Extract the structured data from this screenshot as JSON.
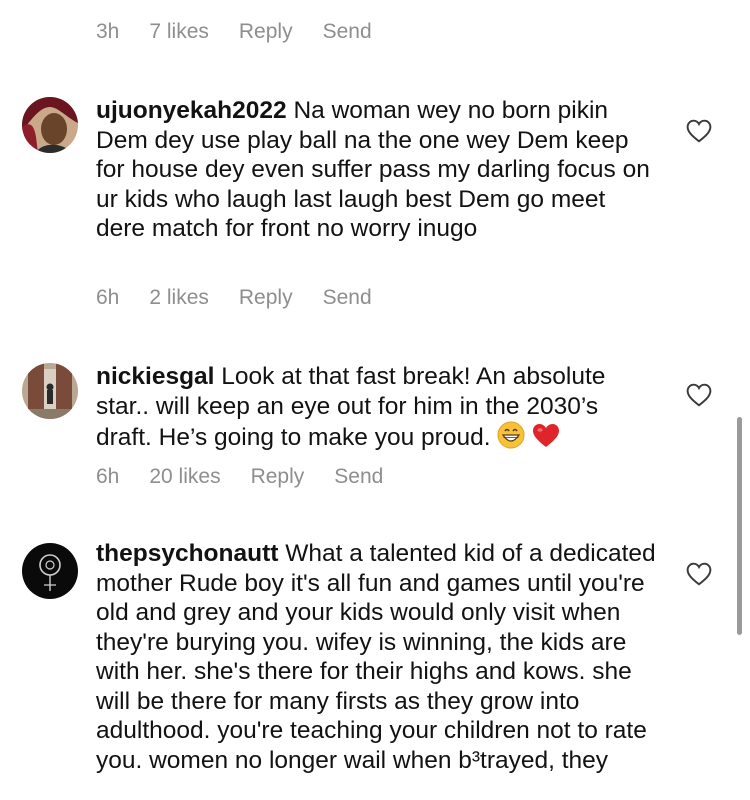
{
  "top_comment": {
    "time": "3h",
    "likes": "7 likes",
    "reply": "Reply",
    "send": "Send"
  },
  "comments": [
    {
      "username": "ujuonyekah2022",
      "text": "Na woman wey no born pikin Dem dey use play ball  na the one wey Dem keep for house dey even suffer pass my darling focus on ur kids who laugh last laugh best Dem go meet dere match for front no worry inugo",
      "time": "6h",
      "likes": "2 likes",
      "reply": "Reply",
      "send": "Send"
    },
    {
      "username": "nickiesgal",
      "text": "Look at that fast break! An absolute star.. will keep an eye out for him in the 2030’s draft. He’s going to make you proud.",
      "emojis": [
        "grinning-face-emoji",
        "red-heart-emoji"
      ],
      "time": "6h",
      "likes": "20 likes",
      "reply": "Reply",
      "send": "Send"
    },
    {
      "username": "thepsychonautt",
      "text": "What a talented kid of a dedicated mother  Rude boy it's all fun and games until you're old and grey and your kids would only visit when they're burying you. wifey is winning, the kids are with her. she's there for their highs and kows. she will be there for many firsts as they grow into adulthood. you're teaching your children not to rate you. women no longer wail when b³trayed, they"
    }
  ],
  "icons": {
    "like": "heart-outline-icon"
  },
  "colors": {
    "meta": "#8e8e8e",
    "text": "#121212",
    "background": "#ffffff",
    "scrollbar": "#9a9a9a"
  }
}
